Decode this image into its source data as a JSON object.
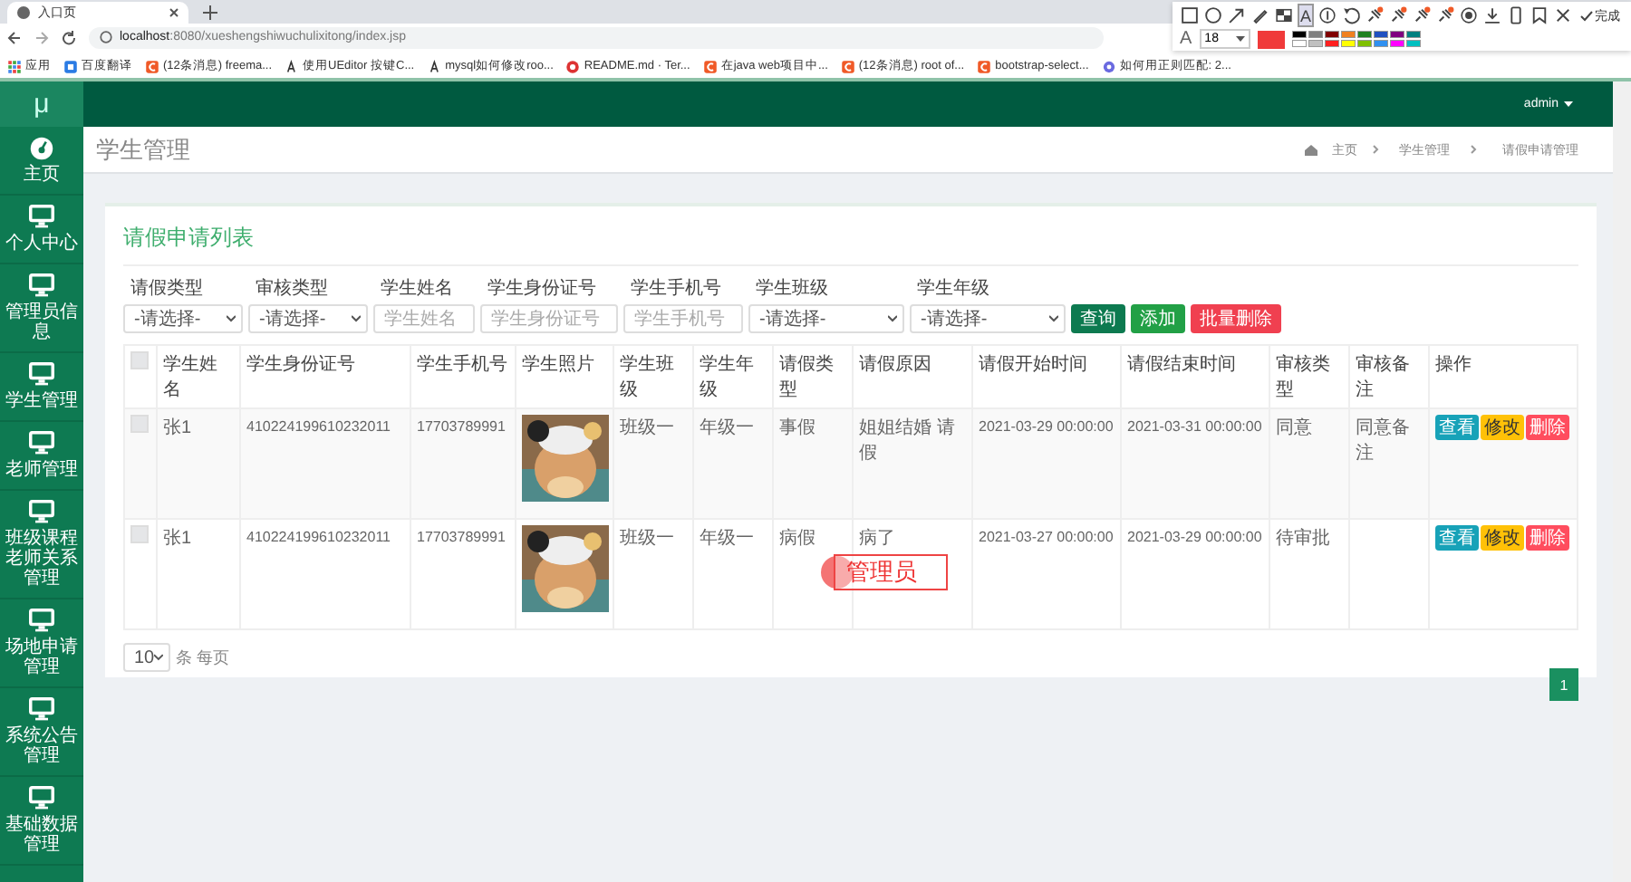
{
  "browser": {
    "tab": {
      "title": "入口页"
    },
    "url_host": "localhost",
    "url_rest": ":8080/xueshengshiwuchulixitong/index.jsp",
    "bookmarks": [
      {
        "label": "应用",
        "kind": "apps"
      },
      {
        "label": "百度翻译",
        "kind": "blue"
      },
      {
        "label": "(12条消息) freema...",
        "kind": "c"
      },
      {
        "label": "使用UEditor 按键C...",
        "kind": "ink"
      },
      {
        "label": "mysql如何修改roo...",
        "kind": "ink"
      },
      {
        "label": "README.md · Ter...",
        "kind": "g"
      },
      {
        "label": "在java web项目中...",
        "kind": "c"
      },
      {
        "label": "(12条消息) root of...",
        "kind": "c"
      },
      {
        "label": "bootstrap-select...",
        "kind": "c"
      },
      {
        "label": "如何用正则匹配: 2...",
        "kind": "gear"
      }
    ]
  },
  "annotation_toolbar": {
    "tools": [
      {
        "kind": "rect",
        "selected": false
      },
      {
        "kind": "ellipse",
        "selected": false
      },
      {
        "kind": "arrow",
        "selected": false
      },
      {
        "kind": "pencil",
        "selected": false
      },
      {
        "kind": "mosaic",
        "selected": false
      },
      {
        "kind": "text",
        "label": "A",
        "selected": true
      },
      {
        "kind": "number",
        "selected": false
      },
      {
        "kind": "undo",
        "selected": false
      },
      {
        "kind": "pin",
        "selected": false
      },
      {
        "kind": "pin",
        "selected": false
      },
      {
        "kind": "pin",
        "selected": false
      },
      {
        "kind": "pin",
        "selected": false
      },
      {
        "kind": "record",
        "selected": false
      },
      {
        "kind": "download",
        "selected": false
      },
      {
        "kind": "phone",
        "selected": false
      },
      {
        "kind": "bookmark",
        "selected": false
      },
      {
        "kind": "close",
        "selected": false
      }
    ],
    "done": "完成",
    "font_label": "A",
    "font_size": "18",
    "current": {
      "color": "#f03a3a"
    },
    "palette": [
      {
        "color": "#000000"
      },
      {
        "color": "#808080"
      },
      {
        "color": "#800000"
      },
      {
        "color": "#f08020"
      },
      {
        "color": "#208020"
      },
      {
        "color": "#2050c0"
      },
      {
        "color": "#800080"
      },
      {
        "color": "#008080"
      },
      {
        "color": "#ffffff"
      },
      {
        "color": "#c0c0c0"
      },
      {
        "color": "#ff2020"
      },
      {
        "color": "#ffff00"
      },
      {
        "color": "#80c000"
      },
      {
        "color": "#3090f0"
      },
      {
        "color": "#ff00ff"
      },
      {
        "color": "#00c0c0"
      }
    ]
  },
  "header": {
    "logo": "μ",
    "user": "admin"
  },
  "sidebar": {
    "items": [
      {
        "label": "主页",
        "kind": "dashboard",
        "selected": false
      },
      {
        "label": "个人中心",
        "kind": "monitor",
        "selected": false
      },
      {
        "label": "管理员信息",
        "kind": "monitor",
        "selected": false
      },
      {
        "label": "学生管理",
        "kind": "monitor",
        "selected": false
      },
      {
        "label": "老师管理",
        "kind": "monitor",
        "selected": false
      },
      {
        "label": "班级课程老师关系管理",
        "kind": "monitor",
        "selected": false
      },
      {
        "label": "场地申请管理",
        "kind": "monitor",
        "selected": false
      },
      {
        "label": "系统公告管理",
        "kind": "monitor",
        "selected": false
      },
      {
        "label": "基础数据管理",
        "kind": "monitor",
        "selected": false
      }
    ]
  },
  "page": {
    "title": "学生管理",
    "breadcrumb": [
      "主页",
      "学生管理",
      "请假申请管理"
    ]
  },
  "card": {
    "title": "请假申请列表",
    "filters": [
      {
        "label": "请假类型",
        "kind": "select",
        "value": "-请选择-"
      },
      {
        "label": "审核类型",
        "kind": "select",
        "value": "-请选择-"
      },
      {
        "label": "学生姓名",
        "kind": "input",
        "placeholder": "学生姓名"
      },
      {
        "label": "学生身份证号",
        "kind": "input",
        "placeholder": "学生身份证号"
      },
      {
        "label": "学生手机号",
        "kind": "input",
        "placeholder": "学生手机号"
      },
      {
        "label": "学生班级",
        "kind": "select",
        "value": "-请选择-"
      },
      {
        "label": "学生年级",
        "kind": "select",
        "value": "-请选择-"
      }
    ],
    "buttons": [
      {
        "label": "查询",
        "kind": "search"
      },
      {
        "label": "添加",
        "kind": "add"
      },
      {
        "label": "批量删除",
        "kind": "danger"
      }
    ],
    "table": {
      "select_all": false,
      "columns": [
        "学生姓名",
        "学生身份证号",
        "学生手机号",
        "学生照片",
        "学生班级",
        "学生年级",
        "请假类型",
        "请假原因",
        "请假开始时间",
        "请假结束时间",
        "审核类型",
        "审核备注",
        "操作"
      ],
      "rows": [
        {
          "checked": false,
          "cells": [
            "张1",
            "410224199610232011",
            "17703789991",
            {
              "kind": "picture"
            },
            "班级一",
            "年级一",
            "事假",
            "姐姐结婚 请假",
            "2021-03-29 00:00:00",
            "2021-03-31 00:00:00",
            "同意",
            "同意备注"
          ],
          "actions": [
            {
              "label": "查看",
              "kind": "view"
            },
            {
              "label": "修改",
              "kind": "edit"
            },
            {
              "label": "删除",
              "kind": "delete"
            }
          ]
        },
        {
          "checked": false,
          "cells": [
            "张1",
            "410224199610232011",
            "17703789991",
            {
              "kind": "picture"
            },
            "班级一",
            "年级一",
            "病假",
            "病了",
            "2021-03-27 00:00:00",
            "2021-03-29 00:00:00",
            "待审批"
          ],
          "actions": [
            {
              "label": "查看",
              "kind": "view"
            },
            {
              "label": "修改",
              "kind": "edit"
            },
            {
              "label": "删除",
              "kind": "delete"
            }
          ]
        }
      ]
    },
    "page_size": "10",
    "page_size_label": "条 每页",
    "pages": [
      {
        "label": "1",
        "selected": true
      }
    ]
  },
  "annotation": {
    "text": "管理员"
  }
}
